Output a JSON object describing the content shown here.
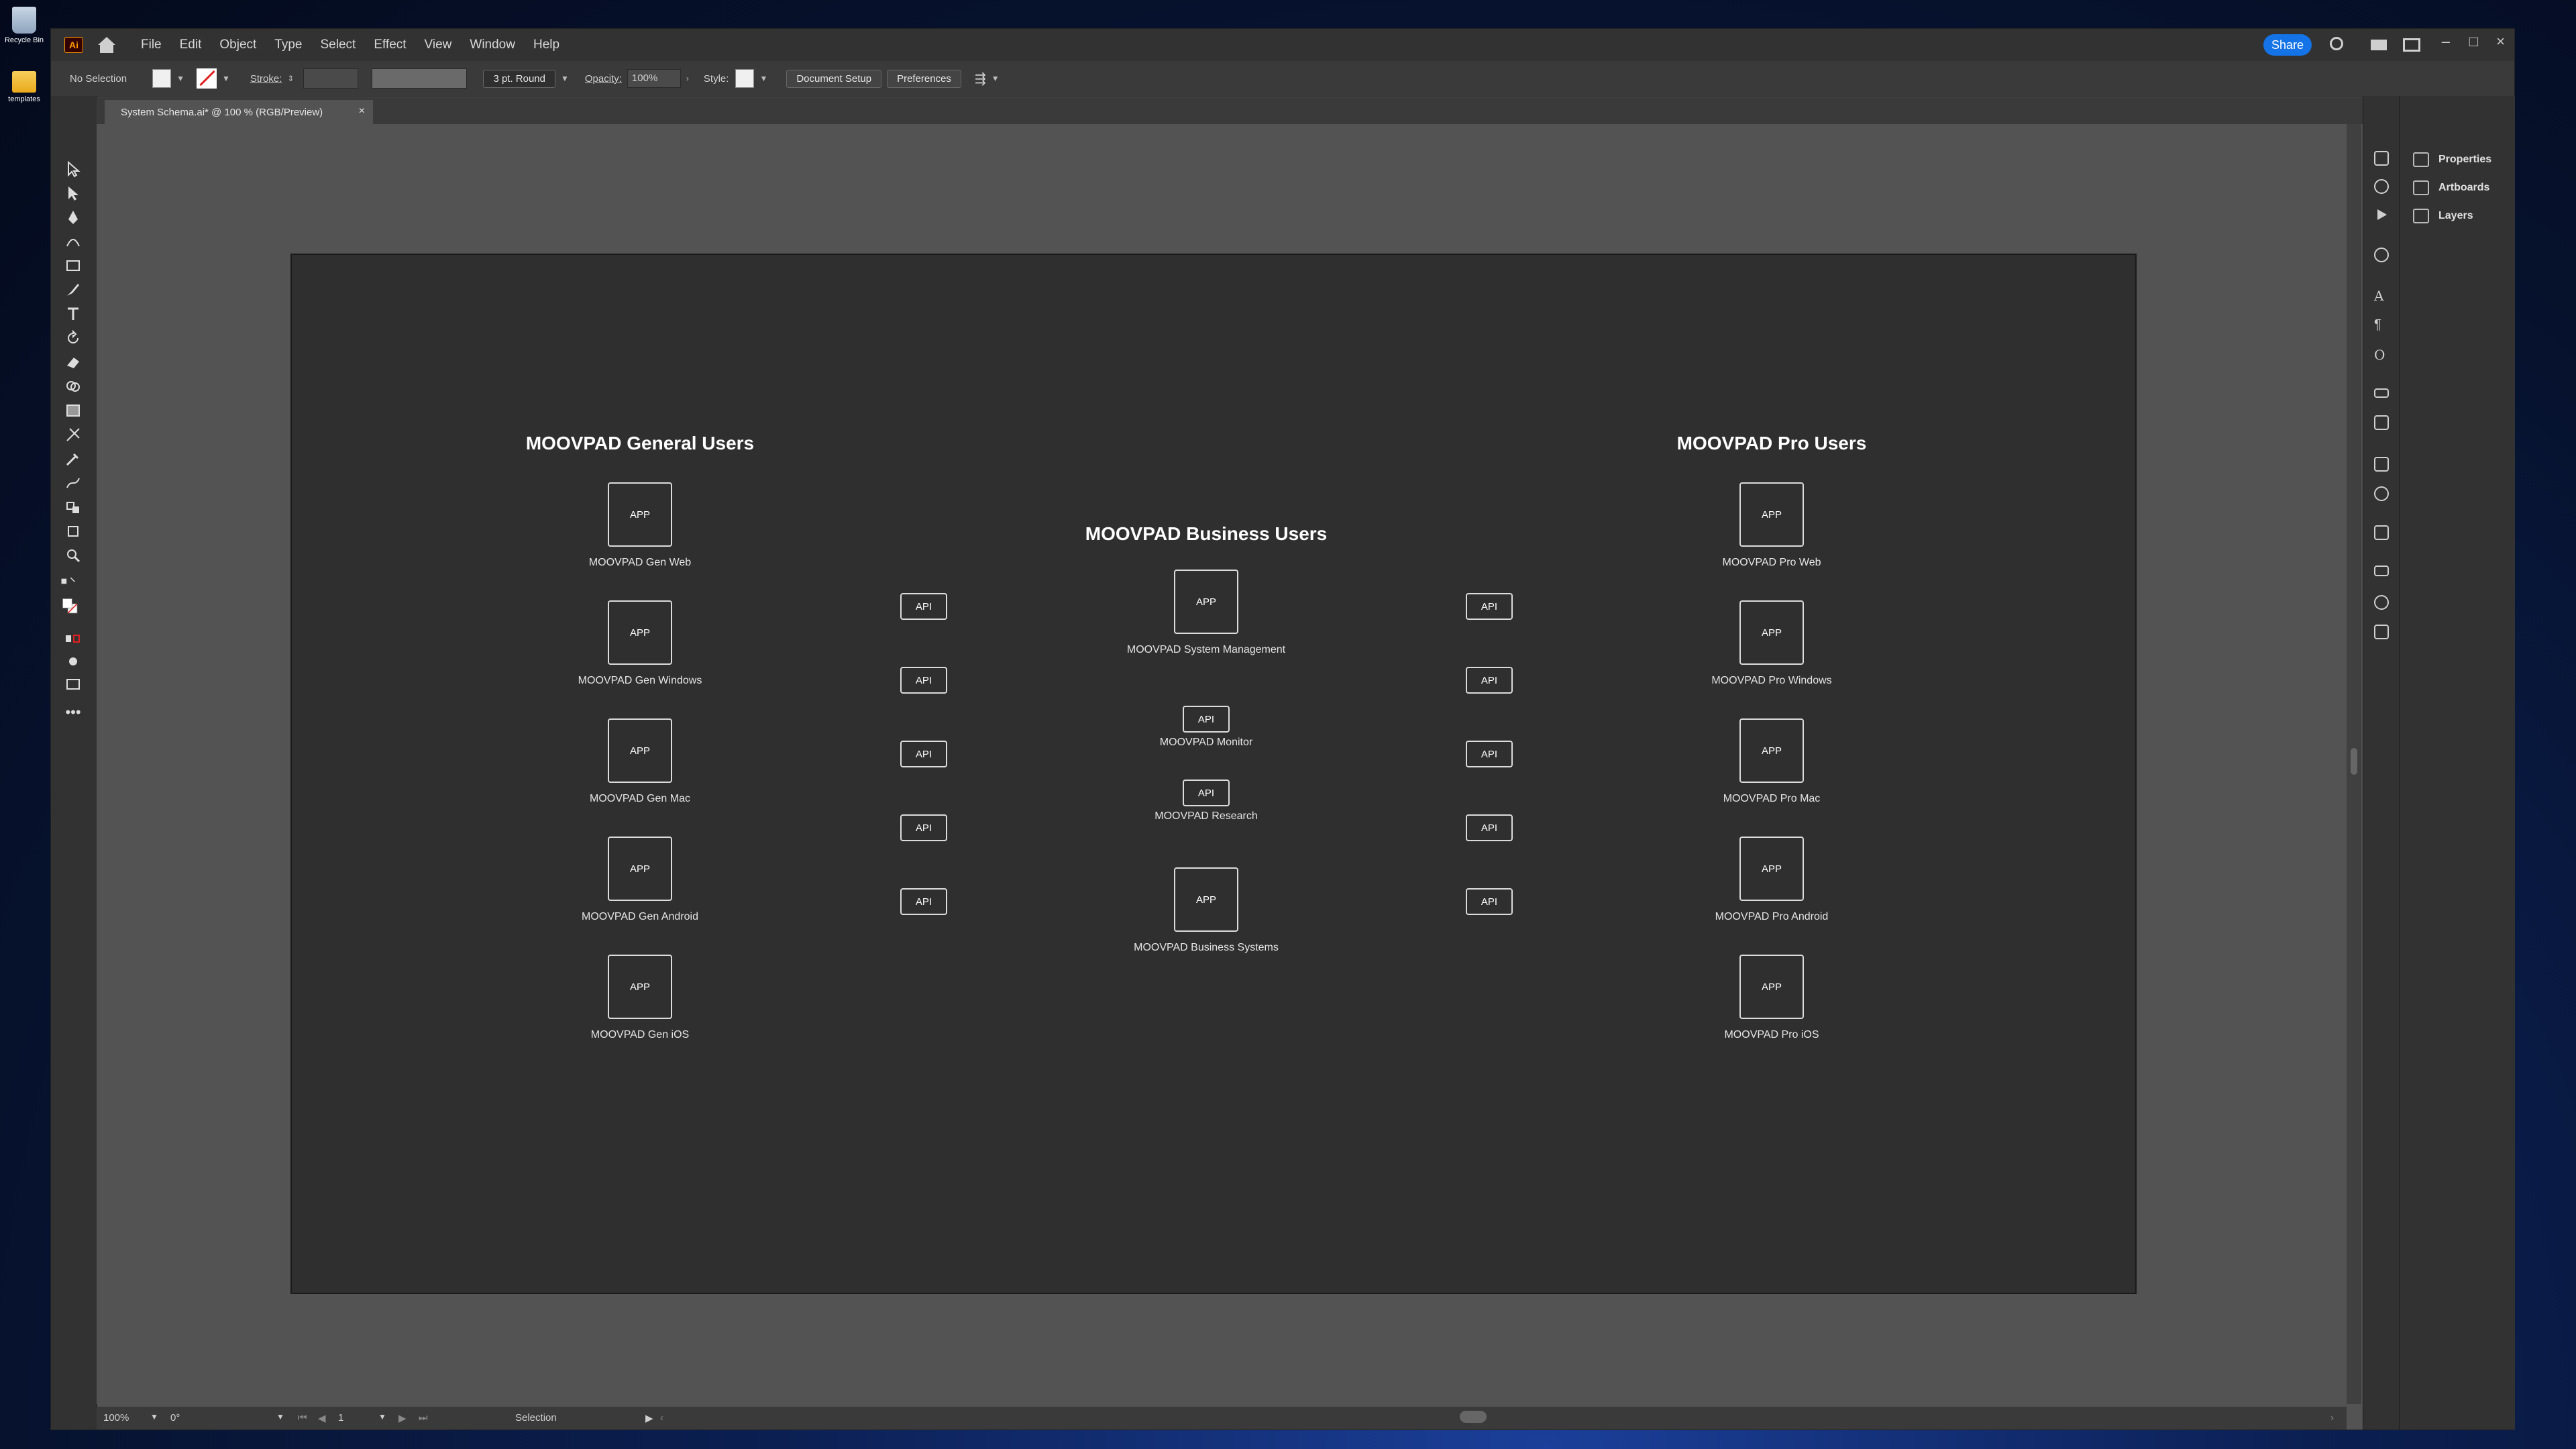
{
  "desktop": {
    "recycle_bin": "Recycle Bin",
    "templates": "templates"
  },
  "app": {
    "logo": "Ai",
    "menu": [
      "File",
      "Edit",
      "Object",
      "Type",
      "Select",
      "Effect",
      "View",
      "Window",
      "Help"
    ],
    "share_label": "Share"
  },
  "control_bar": {
    "selection_state": "No Selection",
    "stroke_label": "Stroke:",
    "brush_label": "3 pt. Round",
    "opacity_label": "Opacity:",
    "opacity_value": "100%",
    "style_label": "Style:",
    "document_setup": "Document Setup",
    "preferences": "Preferences"
  },
  "document_tab": {
    "title": "System Schema.ai* @ 100 % (RGB/Preview)",
    "close": "×"
  },
  "right_panel": {
    "items": [
      "Properties",
      "Artboards",
      "Layers"
    ]
  },
  "status_bar": {
    "zoom": "100%",
    "rotation": "0°",
    "artboard_number": "1",
    "tool": "Selection"
  },
  "diagram": {
    "general": {
      "title": "MOOVPAD General Users",
      "apps": [
        "MOOVPAD Gen Web",
        "MOOVPAD Gen Windows",
        "MOOVPAD Gen Mac",
        "MOOVPAD Gen Android",
        "MOOVPAD Gen iOS"
      ]
    },
    "business": {
      "title": "MOOVPAD Business Users",
      "system_management": "MOOVPAD System Management",
      "monitor": "MOOVPAD Monitor",
      "research": "MOOVPAD Research",
      "business_systems": "MOOVPAD Business Systems"
    },
    "pro": {
      "title": "MOOVPAD Pro Users",
      "apps": [
        "MOOVPAD Pro Web",
        "MOOVPAD Pro Windows",
        "MOOVPAD Pro Mac",
        "MOOVPAD Pro Android",
        "MOOVPAD Pro iOS"
      ]
    },
    "app_label": "APP",
    "api_label": "API"
  }
}
